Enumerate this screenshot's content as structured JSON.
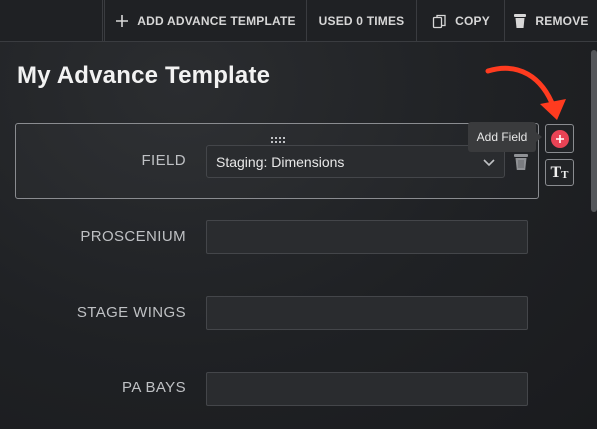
{
  "toolbar": {
    "add_template_label": "ADD ADVANCE TEMPLATE",
    "used_label": "USED 0 TIMES",
    "copy_label": "COPY",
    "remove_label": "REMOVE",
    "icons": {
      "add": "plus-icon",
      "copy": "copy-icon",
      "remove": "trash-icon"
    }
  },
  "template": {
    "title": "My Advance Template"
  },
  "field_card": {
    "label": "FIELD",
    "selected_value": "Staging: Dimensions"
  },
  "rows": [
    {
      "label": "PROSCENIUM",
      "value": ""
    },
    {
      "label": "STAGE WINGS",
      "value": ""
    },
    {
      "label": "PA BAYS",
      "value": ""
    }
  ],
  "controls": {
    "add_field_tooltip": "Add Field",
    "text_button_big": "T",
    "text_button_small": "T"
  },
  "colors": {
    "background": "#1f2124",
    "accent_red": "#e84355",
    "annotation_arrow": "#ff3b1f",
    "border": "#8a8c90"
  }
}
